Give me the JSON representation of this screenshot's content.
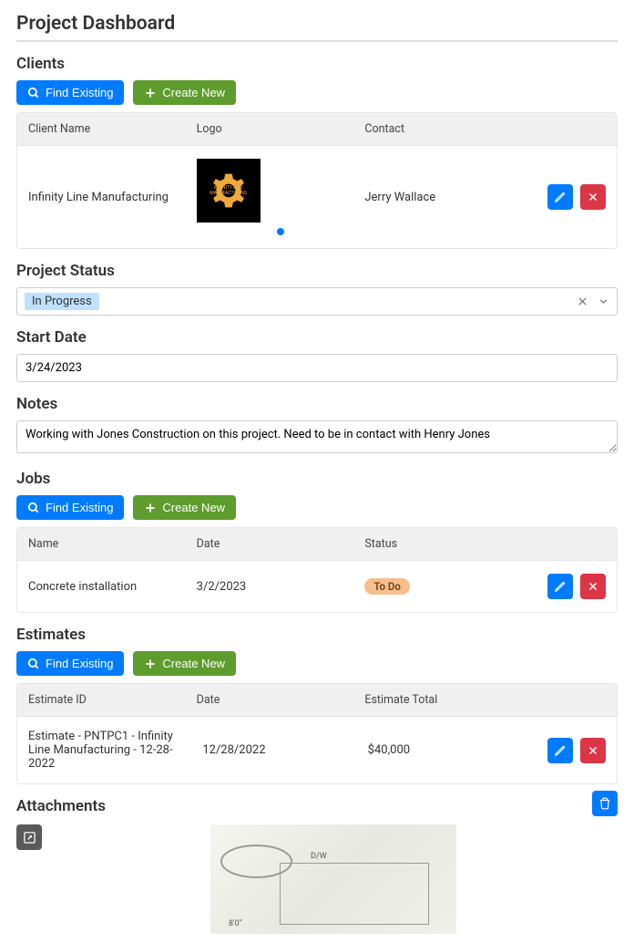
{
  "title": "Project Dashboard",
  "sections": {
    "clients": {
      "heading": "Clients",
      "find_label": "Find Existing",
      "create_label": "Create New",
      "columns": {
        "name": "Client Name",
        "logo": "Logo",
        "contact": "Contact"
      },
      "rows": [
        {
          "name": "Infinity Line Manufacturing",
          "logo_text": "INFINITY LINE MANUFACTURING",
          "contact": "Jerry Wallace"
        }
      ]
    },
    "status": {
      "heading": "Project Status",
      "value": "In Progress"
    },
    "start_date": {
      "heading": "Start Date",
      "value": "3/24/2023"
    },
    "notes": {
      "heading": "Notes",
      "value": "Working with Jones Construction on this project. Need to be in contact with Henry Jones"
    },
    "jobs": {
      "heading": "Jobs",
      "find_label": "Find Existing",
      "create_label": "Create New",
      "columns": {
        "name": "Name",
        "date": "Date",
        "status": "Status"
      },
      "rows": [
        {
          "name": "Concrete installation",
          "date": "3/2/2023",
          "status": "To Do"
        }
      ]
    },
    "estimates": {
      "heading": "Estimates",
      "find_label": "Find Existing",
      "create_label": "Create New",
      "columns": {
        "id": "Estimate ID",
        "date": "Date",
        "total": "Estimate Total"
      },
      "rows": [
        {
          "id": "Estimate - PNTPC1 - Infinity Line Manufacturing - 12-28-2022",
          "date": "12/28/2022",
          "total": "$40,000"
        }
      ]
    },
    "attachments": {
      "heading": "Attachments"
    }
  }
}
